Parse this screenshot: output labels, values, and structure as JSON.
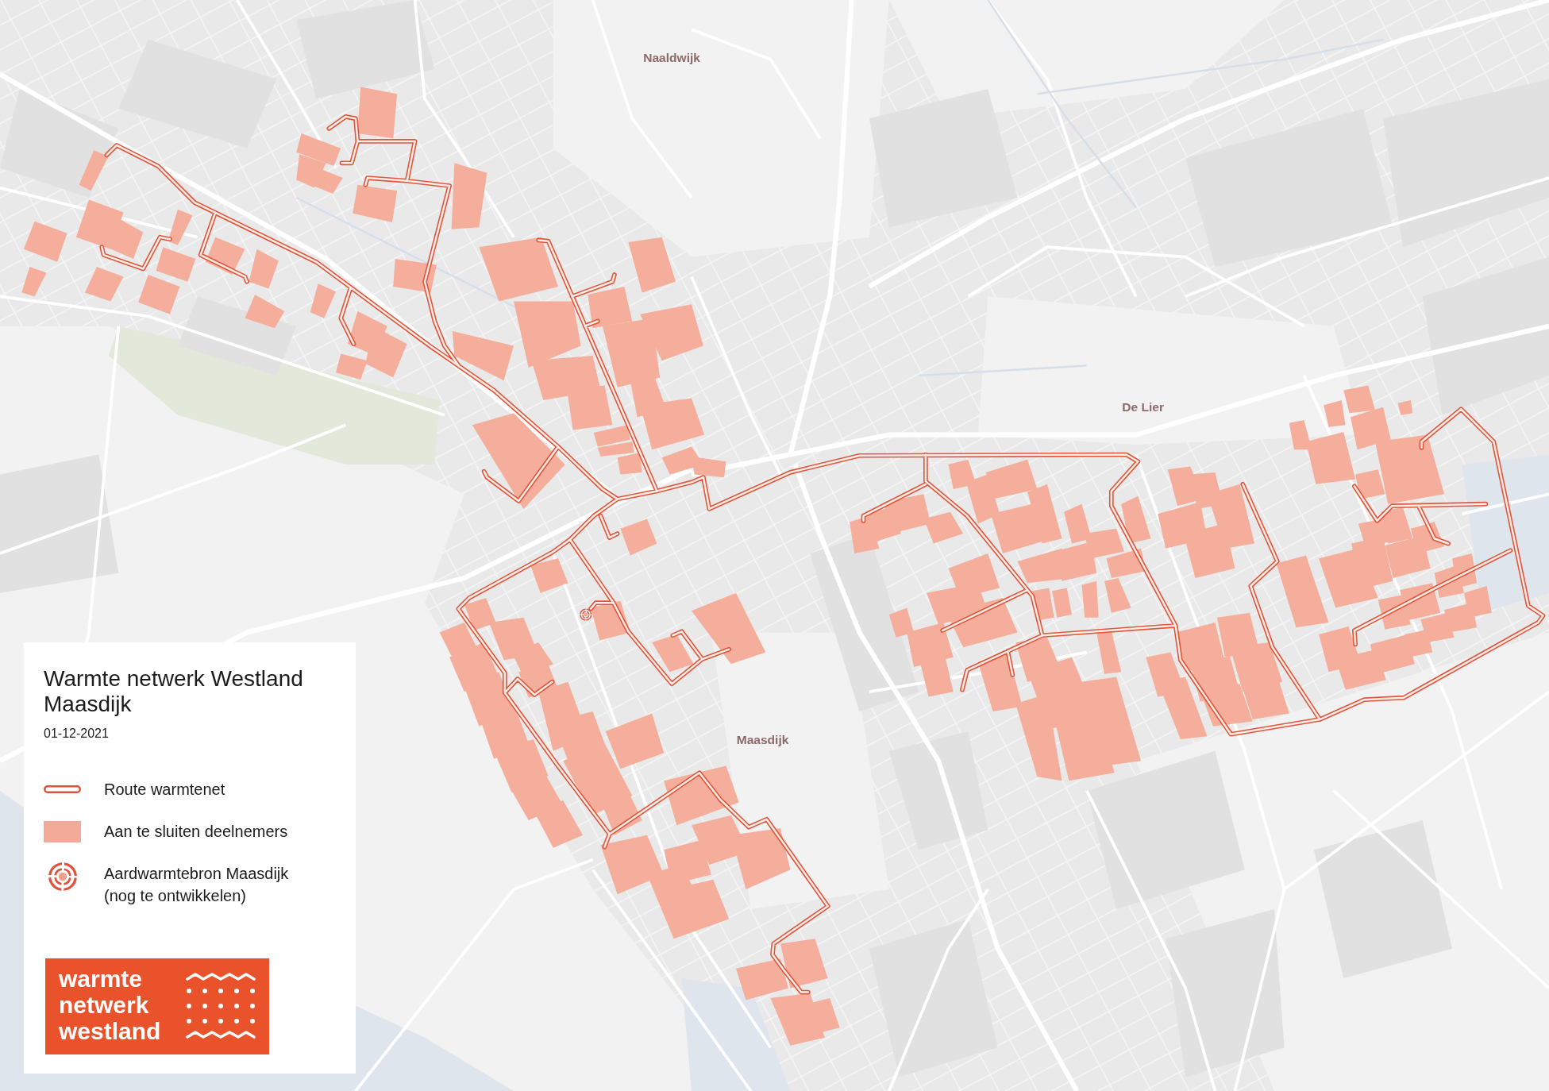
{
  "map": {
    "places": [
      "Naaldwijk",
      "De Lier",
      "Maasdijk"
    ]
  },
  "legend": {
    "title": "Warmte netwerk Westland Maasdijk",
    "date": "01-12-2021",
    "items": [
      {
        "kind": "route",
        "label": "Route warmtenet"
      },
      {
        "kind": "area",
        "label": "Aan te sluiten deelnemers"
      },
      {
        "kind": "source",
        "label": "Aardwarmtebron Maasdijk (nog te ontwikkelen)"
      }
    ],
    "logo": {
      "text": "warmte netwerk westland"
    }
  }
}
